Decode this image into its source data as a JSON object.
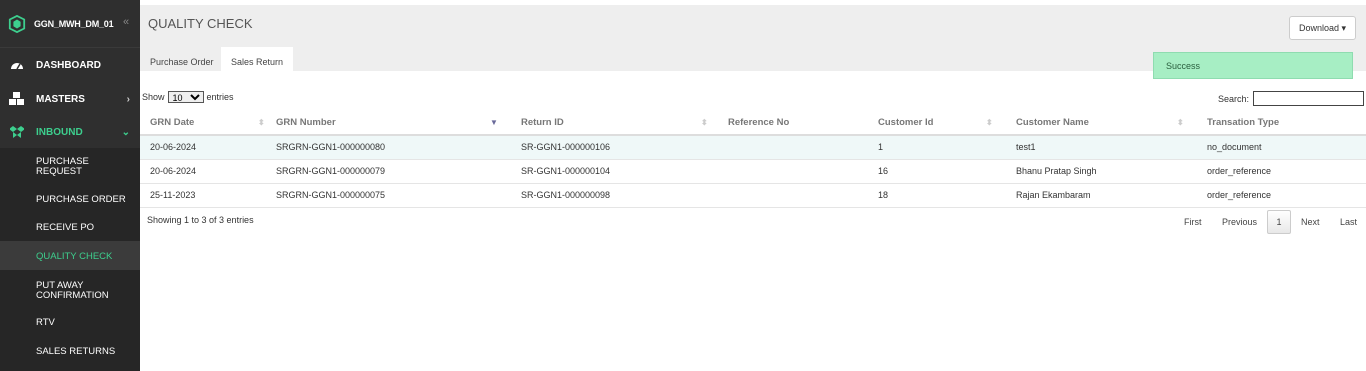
{
  "sidebar": {
    "brand": "GGN_MWH_DM_01",
    "collapse_glyph": "«",
    "items": [
      {
        "label": "DASHBOARD",
        "icon": "dashboard-gauge-icon"
      },
      {
        "label": "MASTERS",
        "icon": "cubes-icon",
        "chevron": "›"
      },
      {
        "label": "INBOUND",
        "icon": "dropbox-icon",
        "chevron": "⌄"
      }
    ],
    "submenu": [
      {
        "line1": "PURCHASE",
        "line2": "REQUEST"
      },
      {
        "line1": "PURCHASE ORDER",
        "line2": ""
      },
      {
        "line1": "RECEIVE PO",
        "line2": ""
      },
      {
        "line1": "QUALITY CHECK",
        "line2": ""
      },
      {
        "line1": "PUT AWAY",
        "line2": "CONFIRMATION"
      },
      {
        "line1": "RTV",
        "line2": ""
      },
      {
        "line1": "SALES RETURNS",
        "line2": ""
      }
    ],
    "colors": {
      "bg": "#2f2f2f",
      "active": "#3dcf8e"
    }
  },
  "header": {
    "title": "QUALITY CHECK",
    "download_label": "Download ▾",
    "tabs": [
      "Purchase Order",
      "Sales Return"
    ],
    "active_tab": "Sales Return"
  },
  "toast": {
    "text": "Success",
    "color": "#a7eec4"
  },
  "table_controls": {
    "show_label": "Show",
    "entries_value": "10",
    "entries_label": "entries",
    "search_label": "Search:"
  },
  "table": {
    "columns": [
      "GRN Date",
      "GRN Number",
      "Return ID",
      "Reference No",
      "Customer Id",
      "Customer Name",
      "Transation Type"
    ],
    "rows": [
      [
        "20-06-2024",
        "SRGRN-GGN1-000000080",
        "SR-GGN1-000000106",
        "",
        "1",
        "test1",
        "no_document"
      ],
      [
        "20-06-2024",
        "SRGRN-GGN1-000000079",
        "SR-GGN1-000000104",
        "",
        "16",
        "Bhanu Pratap Singh",
        "order_reference"
      ],
      [
        "25-11-2023",
        "SRGRN-GGN1-000000075",
        "SR-GGN1-000000098",
        "",
        "18",
        "Rajan Ekambaram",
        "order_reference"
      ]
    ]
  },
  "footer": {
    "info": "Showing 1 to 3 of 3 entries",
    "pager": {
      "first": "First",
      "previous": "Previous",
      "current": "1",
      "next": "Next",
      "last": "Last"
    }
  }
}
